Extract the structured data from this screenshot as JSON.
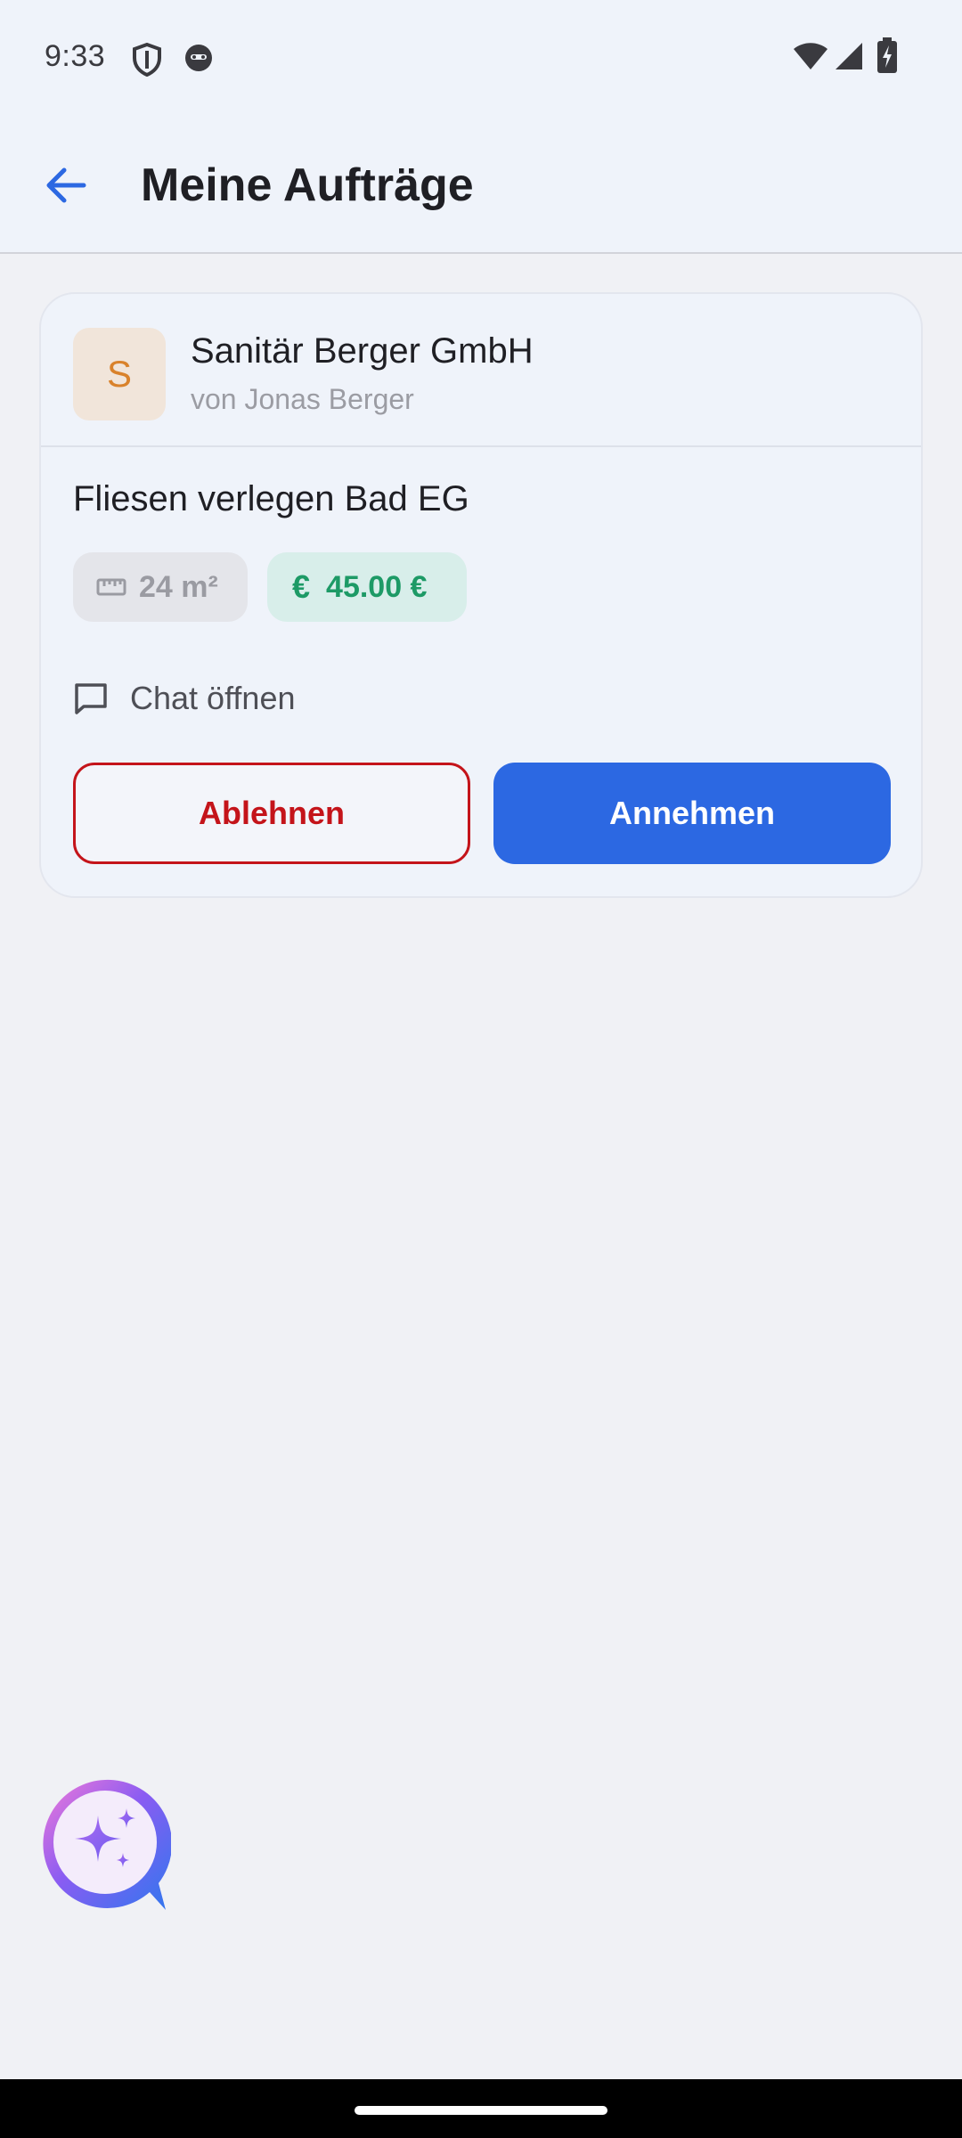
{
  "status_bar": {
    "time": "9:33",
    "icons": [
      "shield-icon",
      "cat-face-icon",
      "wifi-icon",
      "signal-icon",
      "battery-charging-icon"
    ]
  },
  "app_bar": {
    "back_icon": "arrow-left-icon",
    "title": "Meine Aufträge"
  },
  "order_card": {
    "avatar_letter": "S",
    "company_name": "Sanitär Berger GmbH",
    "company_sub": "von Jonas Berger",
    "job_title": "Fliesen verlegen Bad EG",
    "area_chip": {
      "icon": "ruler-icon",
      "label": "24 m²"
    },
    "price_chip": {
      "icon": "euro-icon",
      "symbol": "€",
      "label": "45.00 €"
    },
    "chat_link": {
      "icon": "chat-bubble-icon",
      "label": "Chat öffnen"
    },
    "reject_label": "Ablehnen",
    "accept_label": "Annehmen"
  },
  "assistant_fab": {
    "icon": "sparkle-assistant-icon"
  },
  "colors": {
    "accent": "#2c68e2",
    "reject": "#c4141a",
    "price": "#1d9a66",
    "avatar_letter": "#d9822b",
    "background": "#f0f1f5"
  }
}
